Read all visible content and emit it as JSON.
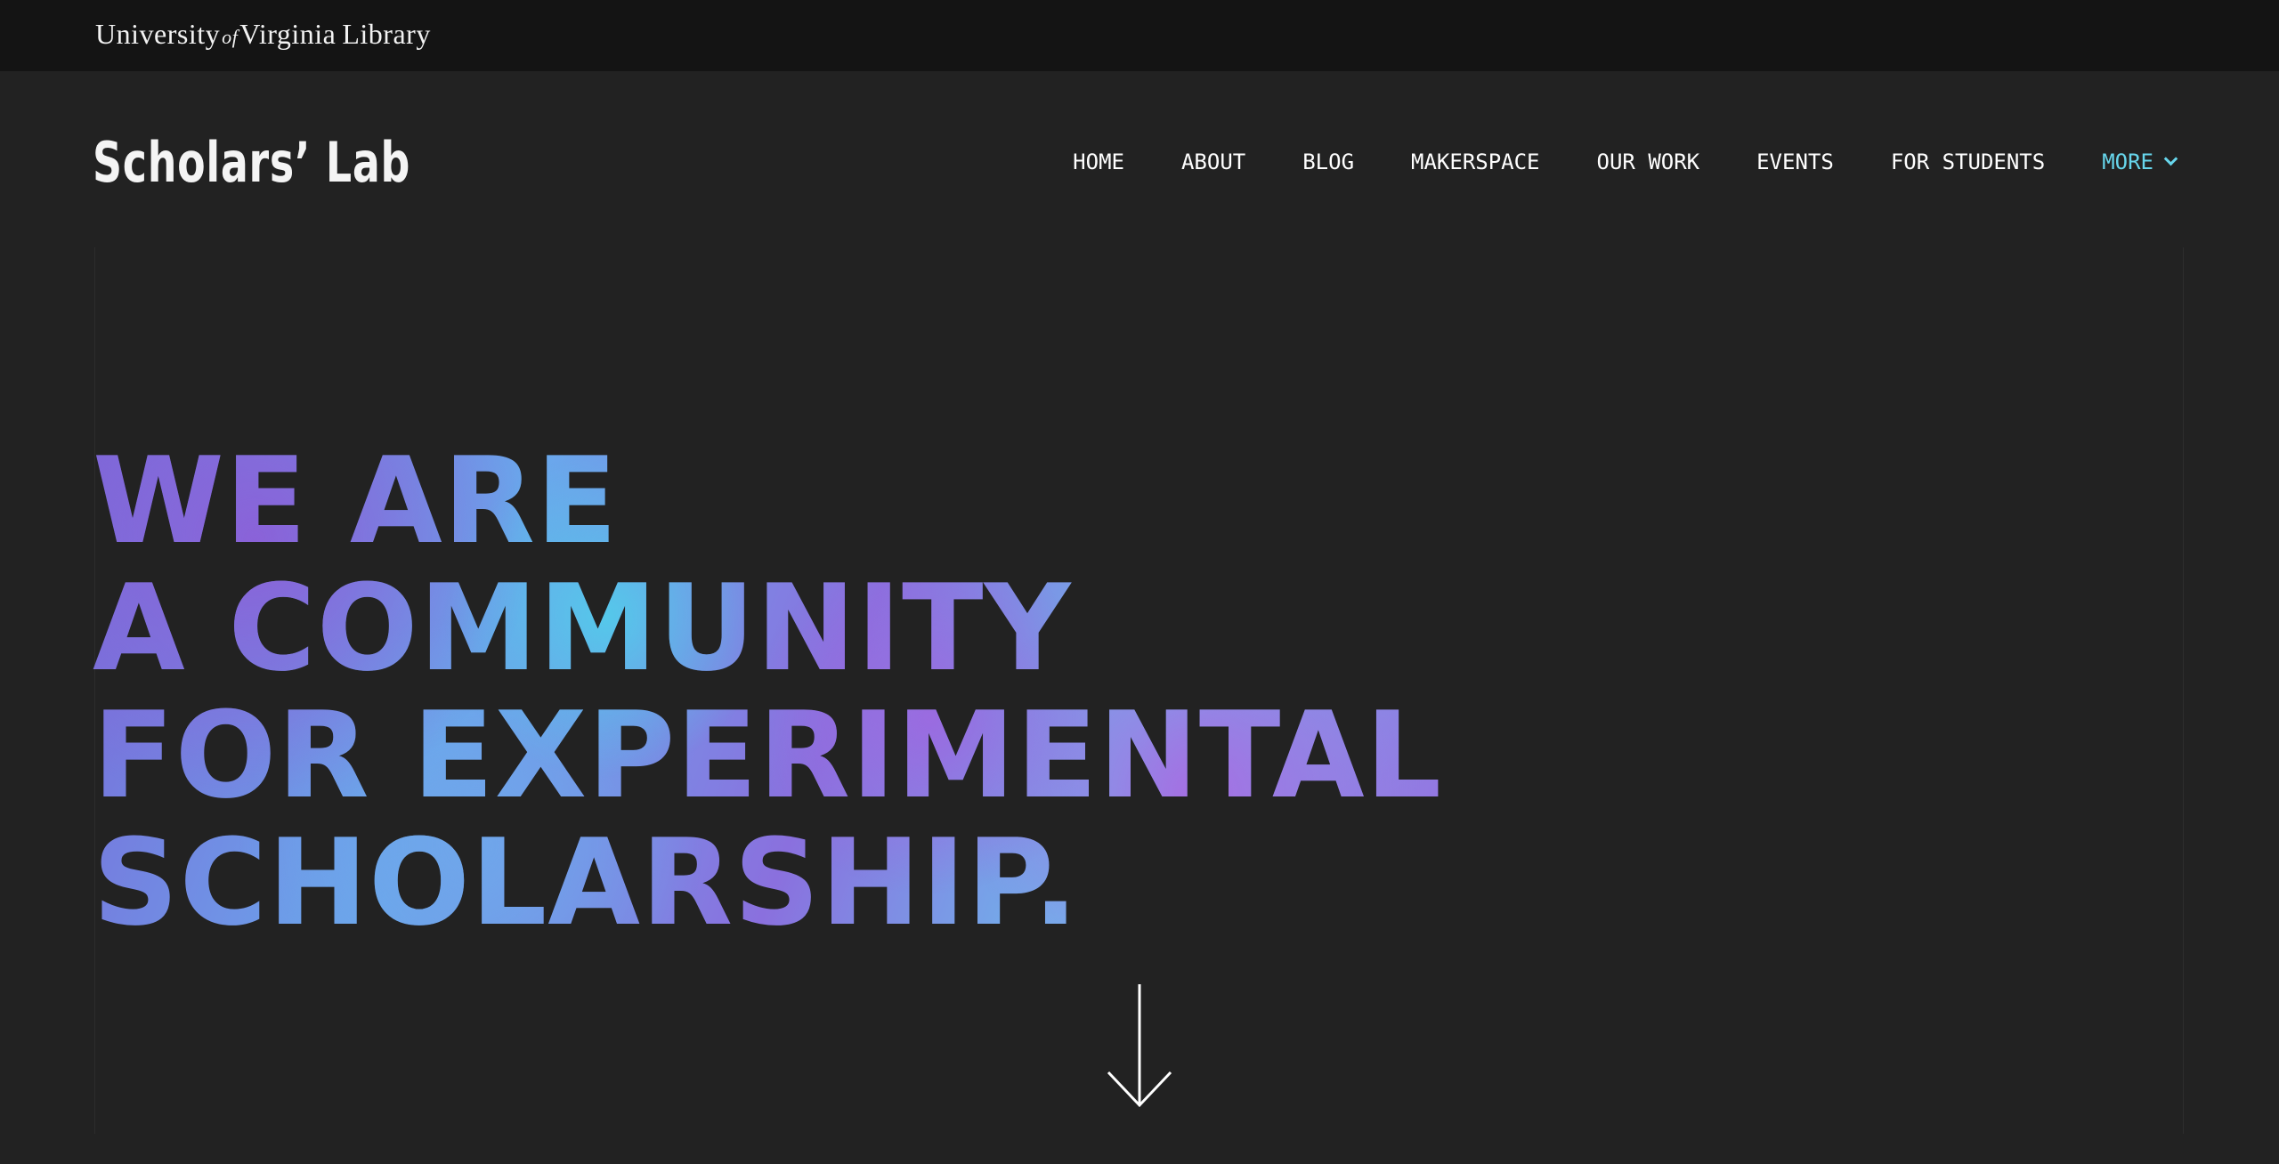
{
  "topbar": {
    "logo": {
      "university": "University",
      "of": "of",
      "virginia": "Virginia",
      "library": "Library"
    }
  },
  "header": {
    "brand": "Scholars’ Lab",
    "nav": [
      {
        "label": "HOME"
      },
      {
        "label": "ABOUT"
      },
      {
        "label": "BLOG"
      },
      {
        "label": "MAKERSPACE"
      },
      {
        "label": "OUR WORK"
      },
      {
        "label": "EVENTS"
      },
      {
        "label": "FOR STUDENTS"
      },
      {
        "label": "MORE"
      }
    ]
  },
  "hero": {
    "lines": [
      "WE ARE",
      "A COMMUNITY",
      "FOR EXPERIMENTAL",
      "SCHOLARSHIP."
    ]
  },
  "icons": {
    "more": "chevron-down-icon",
    "scroll": "arrow-down-icon"
  },
  "colors": {
    "topbar_bg": "#141414",
    "page_bg": "#222222",
    "accent": "#67d6ec",
    "hero_gradient": [
      "#7a68d8",
      "#6aa8ec",
      "#8a70de",
      "#6fb6ec",
      "#9a6ce0"
    ]
  }
}
